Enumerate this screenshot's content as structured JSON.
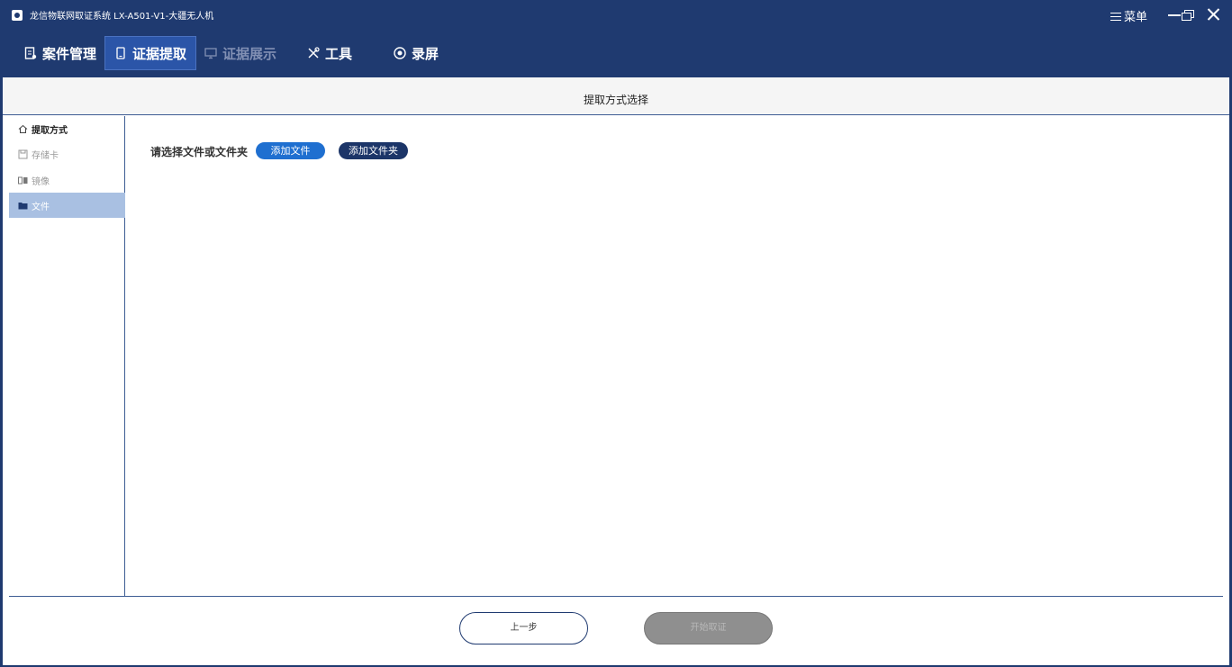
{
  "window": {
    "title": "龙信物联网取证系统 LX-A501-V1-大疆无人机",
    "menu_label": "菜单"
  },
  "nav": {
    "tabs": [
      {
        "label": "案件管理",
        "icon": "document-icon",
        "state": "normal"
      },
      {
        "label": "证据提取",
        "icon": "phone-icon",
        "state": "active"
      },
      {
        "label": "证据展示",
        "icon": "monitor-icon",
        "state": "disabled"
      },
      {
        "label": "工具",
        "icon": "tools-icon",
        "state": "normal"
      },
      {
        "label": "录屏",
        "icon": "record-icon",
        "state": "normal"
      }
    ]
  },
  "section": {
    "title": "提取方式选择"
  },
  "sidebar": {
    "header": "提取方式",
    "items": [
      {
        "label": "存储卡",
        "icon": "sd-card-icon",
        "active": false
      },
      {
        "label": "镜像",
        "icon": "mirror-icon",
        "active": false
      },
      {
        "label": "文件",
        "icon": "folder-icon",
        "active": true
      }
    ]
  },
  "content": {
    "prompt": "请选择文件或文件夹",
    "add_file_label": "添加文件",
    "add_folder_label": "添加文件夹"
  },
  "footer": {
    "prev_label": "上一步",
    "start_label": "开始取证"
  },
  "colors": {
    "header_bg": "#1f3a70",
    "active_tab": "#2b55a8",
    "primary_button": "#1f6fd0",
    "dark_button": "#1c3568",
    "sidebar_active": "#a9c0e2",
    "disabled_button": "#8f8f8f"
  }
}
